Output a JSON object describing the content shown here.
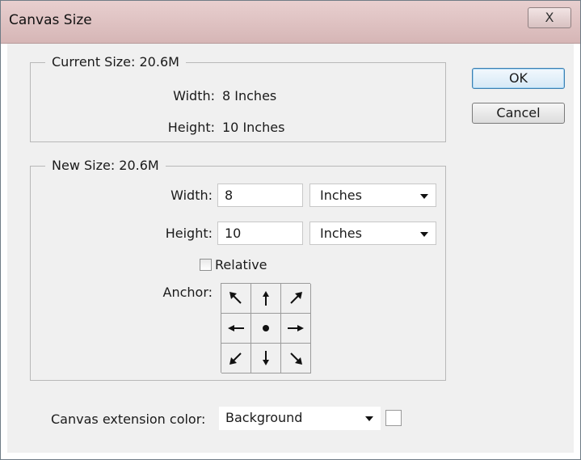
{
  "window": {
    "title": "Canvas Size",
    "close_glyph": "X"
  },
  "current_size": {
    "legend": "Current Size: 20.6M",
    "width_label": "Width:",
    "width_value": "8 Inches",
    "height_label": "Height:",
    "height_value": "10 Inches"
  },
  "new_size": {
    "legend": "New Size: 20.6M",
    "width_label": "Width:",
    "width_value": "8",
    "width_unit": "Inches",
    "height_label": "Height:",
    "height_value": "10",
    "height_unit": "Inches",
    "relative_label": "Relative",
    "relative_checked": false,
    "anchor_label": "Anchor:",
    "anchor_icons": [
      "arrow-up-left-icon",
      "arrow-up-icon",
      "arrow-up-right-icon",
      "arrow-left-icon",
      "anchor-center-dot-icon",
      "arrow-right-icon",
      "arrow-down-left-icon",
      "arrow-down-icon",
      "arrow-down-right-icon"
    ]
  },
  "extension": {
    "label": "Canvas extension color:",
    "value": "Background",
    "swatch_color": "#ffffff"
  },
  "buttons": {
    "ok": "OK",
    "cancel": "Cancel"
  }
}
